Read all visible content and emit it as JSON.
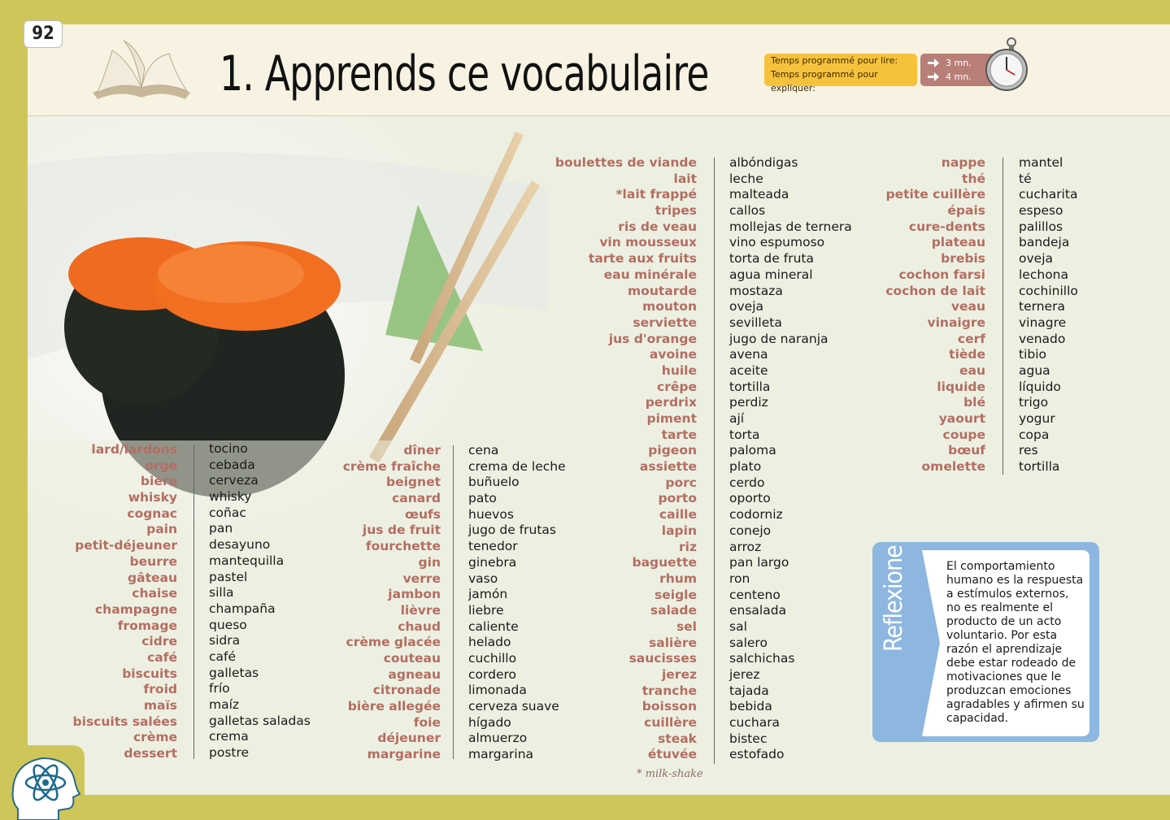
{
  "header": {
    "page_number": "92",
    "title": "1. Apprends ce vocabulaire",
    "timer": {
      "read_label": "Temps programmé pour lire:",
      "explain_label": "Temps programmé pour expliquer:",
      "read_value": "3 mn.",
      "explain_value": "4 mn."
    },
    "icons": [
      "book-icon",
      "arrow-icon",
      "stopwatch-icon",
      "atom-head-icon"
    ]
  },
  "colors": {
    "border": "#cfc65a",
    "french_word": "#b46d63",
    "timer_label": "#f7c23b",
    "timer_value": "#b77f78",
    "reflexion": "#8db7e0"
  },
  "vocab": {
    "col1": [
      [
        "lard/lardons",
        "tocino"
      ],
      [
        "orge",
        "cebada"
      ],
      [
        "bière",
        "cerveza"
      ],
      [
        "whisky",
        "whisky"
      ],
      [
        "cognac",
        "coñac"
      ],
      [
        "pain",
        "pan"
      ],
      [
        "petit-déjeuner",
        "desayuno"
      ],
      [
        "beurre",
        "mantequilla"
      ],
      [
        "gâteau",
        "pastel"
      ],
      [
        "chaise",
        "silla"
      ],
      [
        "champagne",
        "champaña"
      ],
      [
        "fromage",
        "queso"
      ],
      [
        "cidre",
        "sidra"
      ],
      [
        "café",
        "café"
      ],
      [
        "biscuits",
        "galletas"
      ],
      [
        "froid",
        "frío"
      ],
      [
        "maïs",
        "maíz"
      ],
      [
        "biscuits salées",
        "galletas saladas"
      ],
      [
        "crème",
        "crema"
      ],
      [
        "dessert",
        "postre"
      ]
    ],
    "col2": [
      [
        "dîner",
        "cena"
      ],
      [
        "crème fraîche",
        "crema de leche"
      ],
      [
        "beignet",
        "buñuelo"
      ],
      [
        "canard",
        "pato"
      ],
      [
        "œufs",
        "huevos"
      ],
      [
        "jus de fruit",
        "jugo de frutas"
      ],
      [
        "fourchette",
        "tenedor"
      ],
      [
        "gin",
        "ginebra"
      ],
      [
        "verre",
        "vaso"
      ],
      [
        "jambon",
        "jamón"
      ],
      [
        "lièvre",
        "liebre"
      ],
      [
        "chaud",
        "caliente"
      ],
      [
        "crème glacée",
        "helado"
      ],
      [
        "couteau",
        "cuchillo"
      ],
      [
        "agneau",
        "cordero"
      ],
      [
        "citronade",
        "limonada"
      ],
      [
        "bière allegée",
        "cerveza suave"
      ],
      [
        "foie",
        "hígado"
      ],
      [
        "déjeuner",
        "almuerzo"
      ],
      [
        "margarine",
        "margarina"
      ]
    ],
    "col3": [
      [
        "boulettes de viande",
        "albóndigas"
      ],
      [
        "lait",
        "leche"
      ],
      [
        "*lait frappé",
        "malteada"
      ],
      [
        "tripes",
        "callos"
      ],
      [
        "ris de veau",
        "mollejas de ternera"
      ],
      [
        "vin mousseux",
        "vino espumoso"
      ],
      [
        "tarte aux fruits",
        "torta de fruta"
      ],
      [
        "eau minérale",
        "agua mineral"
      ],
      [
        "moutarde",
        "mostaza"
      ],
      [
        "mouton",
        "oveja"
      ],
      [
        "serviette",
        "sevilleta"
      ],
      [
        "jus d'orange",
        "jugo de naranja"
      ],
      [
        "avoine",
        "avena"
      ],
      [
        "huile",
        "aceite"
      ],
      [
        "crêpe",
        "tortilla"
      ],
      [
        "perdrix",
        "perdiz"
      ],
      [
        "piment",
        "ají"
      ],
      [
        "tarte",
        "torta"
      ],
      [
        "pigeon",
        "paloma"
      ],
      [
        "assiette",
        "plato"
      ],
      [
        "porc",
        "cerdo"
      ],
      [
        "porto",
        "oporto"
      ],
      [
        "caille",
        "codorniz"
      ],
      [
        "lapin",
        "conejo"
      ],
      [
        "riz",
        "arroz"
      ],
      [
        "baguette",
        "pan largo"
      ],
      [
        "rhum",
        "ron"
      ],
      [
        "seigle",
        "centeno"
      ],
      [
        "salade",
        "ensalada"
      ],
      [
        "sel",
        "sal"
      ],
      [
        "salière",
        "salero"
      ],
      [
        "saucisses",
        "salchichas"
      ],
      [
        "jerez",
        "jerez"
      ],
      [
        "tranche",
        "tajada"
      ],
      [
        "boisson",
        "bebida"
      ],
      [
        "cuillère",
        "cuchara"
      ],
      [
        "steak",
        "bistec"
      ],
      [
        "étuvée",
        "estofado"
      ]
    ],
    "col4": [
      [
        "nappe",
        "mantel"
      ],
      [
        "thé",
        "té"
      ],
      [
        "petite cuillère",
        "cucharita"
      ],
      [
        "épais",
        "espeso"
      ],
      [
        "cure-dents",
        "palillos"
      ],
      [
        "plateau",
        "bandeja"
      ],
      [
        "brebis",
        "oveja"
      ],
      [
        "cochon farsi",
        "lechona"
      ],
      [
        "cochon de lait",
        "cochinillo"
      ],
      [
        "veau",
        "ternera"
      ],
      [
        "vinaigre",
        "vinagre"
      ],
      [
        "cerf",
        "venado"
      ],
      [
        "tiède",
        "tibio"
      ],
      [
        "eau",
        "agua"
      ],
      [
        "liquide",
        "líquido"
      ],
      [
        "blé",
        "trigo"
      ],
      [
        "yaourt",
        "yogur"
      ],
      [
        "coupe",
        "copa"
      ],
      [
        "bœuf",
        "res"
      ],
      [
        "omelette",
        "tortilla"
      ]
    ]
  },
  "footnote": "* milk-shake",
  "reflexion": {
    "title": "Reflexione",
    "text": "El comportamiento humano es la respuesta a estímulos externos, no es realmente el producto de un acto voluntario. Por esta razón el aprendizaje debe estar rodeado de motivaciones que le produzcan emociones agradables y afirmen su capacidad."
  }
}
